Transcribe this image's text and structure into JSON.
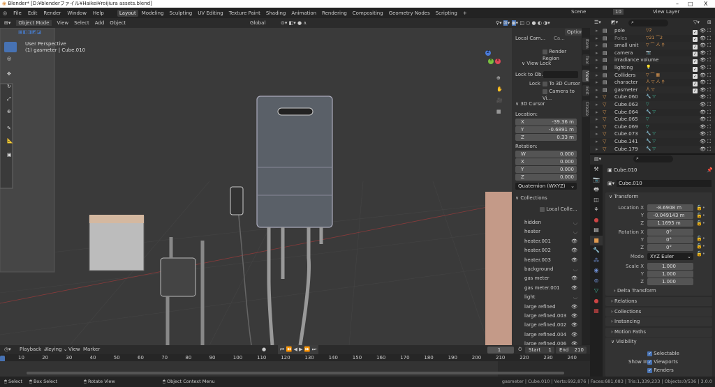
{
  "window": {
    "title": "Blender* [D:¥blenderファイル¥Haikei¥roijiura assets.blend]",
    "controls": [
      "–",
      "□",
      "X"
    ]
  },
  "menu": [
    "File",
    "Edit",
    "Render",
    "Window",
    "Help"
  ],
  "workspaces": [
    "Layout",
    "Modeling",
    "Sculpting",
    "UV Editing",
    "Texture Paint",
    "Shading",
    "Animation",
    "Rendering",
    "Compositing",
    "Geometry Nodes",
    "Scripting",
    "+"
  ],
  "scene": {
    "name": "Scene",
    "count": "10",
    "view_layer": "View Layer"
  },
  "viewport_header": {
    "mode": "Object Mode",
    "menus": [
      "View",
      "Select",
      "Add",
      "Object"
    ],
    "orientation": "Global",
    "options": "Options"
  },
  "viewport": {
    "perspective": "User Perspective",
    "context": "(1) gasmeter | Cube.010"
  },
  "npanel": {
    "tabs": [
      "Item",
      "Tool",
      "View",
      "Edit",
      "Create"
    ],
    "local_camera": "Local Cam...",
    "camera_field": "Ca...",
    "render_region": "Render Region",
    "view_lock": "View Lock",
    "lock_to_obj": "Lock to Ob...",
    "lock": "Lock",
    "to_3d_cursor": "To 3D Cursor",
    "camera_to_view": "Camera to Vi...",
    "cursor": {
      "title": "3D Cursor",
      "location": "Location:",
      "x": "-39.36 m",
      "y": "-0.6891 m",
      "z": "0.33 m",
      "rotation": "Rotation:",
      "w": "0.000",
      "rx": "0.000",
      "ry": "0.000",
      "rz": "0.000",
      "mode": "Quaternion (WXYZ)"
    },
    "collections": {
      "title": "Collections",
      "local": "Local Colle...",
      "items": [
        {
          "name": "hidden",
          "visible": false
        },
        {
          "name": "heater",
          "visible": false
        },
        {
          "name": "heater.001",
          "visible": true
        },
        {
          "name": "heater.002",
          "visible": true
        },
        {
          "name": "heater.003",
          "visible": true
        },
        {
          "name": "background",
          "visible": false
        },
        {
          "name": "gas meter",
          "visible": true
        },
        {
          "name": "gas meter.001",
          "visible": true
        },
        {
          "name": "light",
          "visible": false
        },
        {
          "name": "large refined",
          "visible": true
        },
        {
          "name": "large refined.003",
          "visible": true
        },
        {
          "name": "large refined.002",
          "visible": true
        },
        {
          "name": "large refined.004",
          "visible": true
        },
        {
          "name": "large refined.006",
          "visible": true
        }
      ]
    }
  },
  "axes": {
    "x": "X",
    "y": "Y",
    "z": "Z"
  },
  "outliner": {
    "items": [
      {
        "name": "pole",
        "type": "collection",
        "badges": "▽2"
      },
      {
        "name": "Poles",
        "type": "collection",
        "badges": "▽21 ⌒2",
        "dim": true
      },
      {
        "name": "small unit",
        "type": "collection",
        "badges": "▽ ⌒ 人 ⚲"
      },
      {
        "name": "camera",
        "type": "collection",
        "badges": "📷"
      },
      {
        "name": "irradiance volume",
        "type": "collection",
        "badges": ""
      },
      {
        "name": "lighting",
        "type": "collection",
        "badges": "💡"
      },
      {
        "name": "Colliders",
        "type": "collection",
        "badges": "▽ ⌒ ▦"
      },
      {
        "name": "character",
        "type": "collection",
        "badges": "人 ▽ 人 ⚲"
      },
      {
        "name": "gasmeter",
        "type": "collection",
        "badges": "人 ▽"
      },
      {
        "name": "Cube.060",
        "type": "mesh",
        "badges": "🔧 ▽"
      },
      {
        "name": "Cube.063",
        "type": "mesh",
        "badges": "▽"
      },
      {
        "name": "Cube.064",
        "type": "mesh",
        "badges": "🔧 ▽"
      },
      {
        "name": "Cube.065",
        "type": "mesh",
        "badges": "▽"
      },
      {
        "name": "Cube.069",
        "type": "mesh",
        "badges": "▽"
      },
      {
        "name": "Cube.073",
        "type": "mesh",
        "badges": "🔧 ▽"
      },
      {
        "name": "Cube.141",
        "type": "mesh",
        "badges": "🔧 ▽"
      },
      {
        "name": "Cube.179",
        "type": "mesh",
        "badges": "🔧 ▽"
      }
    ]
  },
  "properties": {
    "object": "Cube.010",
    "data_name": "Cube.010",
    "transform": "Transform",
    "location_x_label": "Location X",
    "loc": [
      "-8.6908 m",
      "-0.049143 m",
      "1.1695 m"
    ],
    "rotation_x_label": "Rotation X",
    "rot": [
      "0°",
      "0°",
      "0°"
    ],
    "mode_label": "Mode",
    "mode": "XYZ Euler",
    "scale_x_label": "Scale X",
    "scale": [
      "1.000",
      "1.000",
      "1.000"
    ],
    "y": "Y",
    "z": "Z",
    "delta": "Delta Transform",
    "sections": [
      "Relations",
      "Collections",
      "Instancing",
      "Motion Paths"
    ],
    "visibility": "Visibility",
    "selectable": "Selectable",
    "show_in": "Show In",
    "viewports": "Viewports",
    "renders": "Renders"
  },
  "timeline": {
    "menus": [
      "Playback",
      "Keying",
      "View",
      "Marker"
    ],
    "current_frame": "1",
    "start_label": "Start",
    "start": "1",
    "end_label": "End",
    "end": "210",
    "ticks": [
      "10",
      "20",
      "30",
      "40",
      "50",
      "60",
      "70",
      "80",
      "90",
      "100",
      "110",
      "120",
      "130",
      "140",
      "150",
      "160",
      "170",
      "180",
      "190",
      "200",
      "210",
      "220",
      "230",
      "240"
    ]
  },
  "status": {
    "select": "Select",
    "box_select": "Box Select",
    "rotate": "Rotate View",
    "context_menu": "Object Context Menu",
    "stats": "gasmeter | Cube.010 | Verts:692,876 | Faces:681,083 | Tris:1,339,233 | Objects:0/536 | 3.0.0"
  },
  "colors": {
    "accent": "#4772b3",
    "orange": "#e09a50",
    "green": "#3fb99a",
    "viewport": "#3a3a3a"
  }
}
